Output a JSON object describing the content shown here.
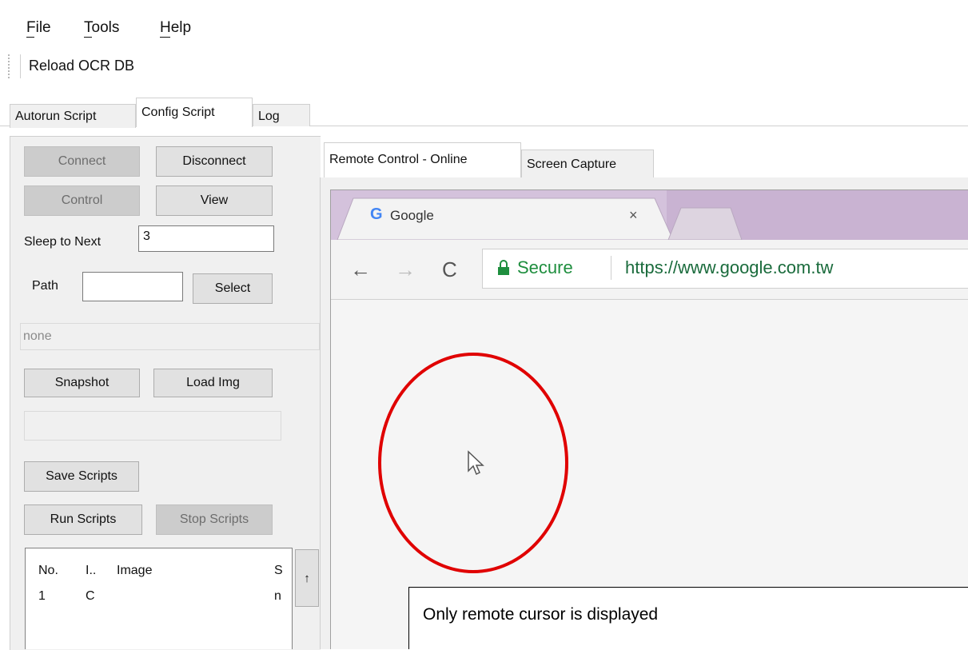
{
  "menu": {
    "file": "File",
    "tools": "Tools",
    "help": "Help"
  },
  "toolbar": {
    "reload_ocr_db": "Reload OCR DB"
  },
  "main_tabs": [
    "Autorun Script",
    "Config Script",
    "Log"
  ],
  "left_panel": {
    "connect": "Connect",
    "disconnect": "Disconnect",
    "control": "Control",
    "view": "View",
    "sleep_label": "Sleep to Next",
    "sleep_value": "3",
    "path_label": "Path",
    "path_value": "",
    "select": "Select",
    "status": "none",
    "snapshot": "Snapshot",
    "load_img": "Load Img",
    "save_scripts": "Save Scripts",
    "run_scripts": "Run Scripts",
    "stop_scripts": "Stop Scripts",
    "table": {
      "headers": [
        "No.",
        "I..",
        "Image",
        "S"
      ],
      "rows": [
        [
          "1",
          "C",
          "",
          "n"
        ]
      ]
    },
    "scroll_up": "↑"
  },
  "right_tabs": [
    "Remote Control - Online",
    "Screen Capture"
  ],
  "browser": {
    "tab_title": "Google",
    "secure_label": "Secure",
    "url": "https://www.google.com.tw",
    "tab_color": "#d9c8de",
    "lock_color": "#1e8e3e",
    "url_color": "#1a6b3c"
  },
  "annotation": {
    "text": "Only remote cursor is displayed",
    "circle_color": "#e00000"
  }
}
